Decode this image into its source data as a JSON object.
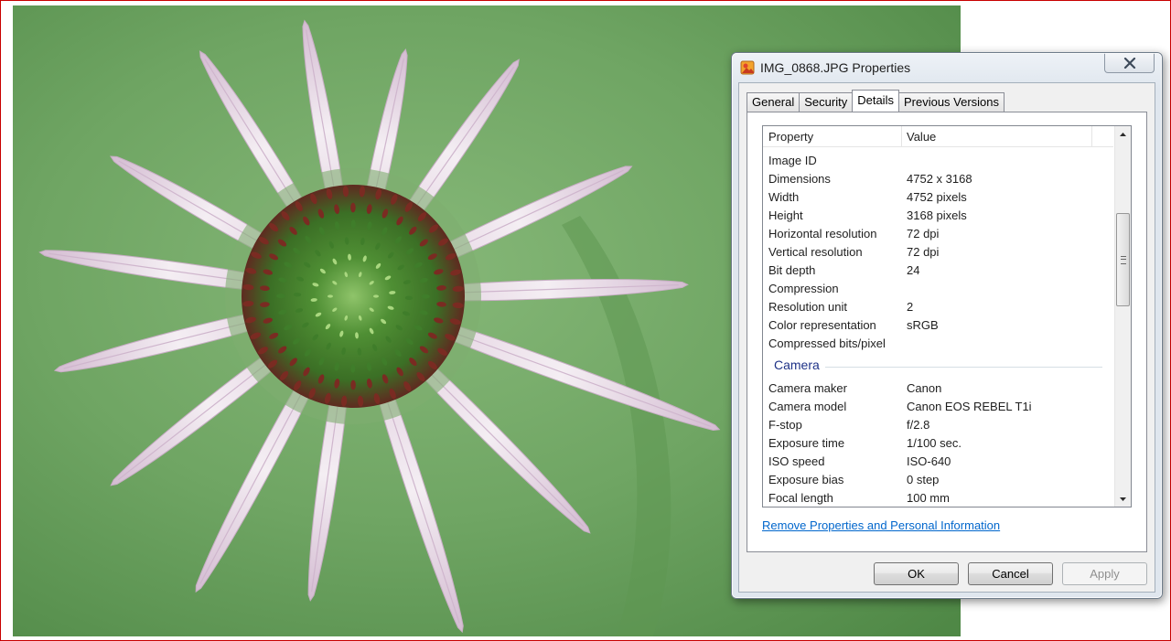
{
  "window": {
    "title": "IMG_0868.JPG Properties"
  },
  "tabs": [
    {
      "label": "General"
    },
    {
      "label": "Security"
    },
    {
      "label": "Details"
    },
    {
      "label": "Previous Versions"
    }
  ],
  "active_tab": "Details",
  "list": {
    "header_property": "Property",
    "header_value": "Value",
    "image_rows": [
      {
        "property": "Image ID",
        "value": ""
      },
      {
        "property": "Dimensions",
        "value": "4752 x 3168"
      },
      {
        "property": "Width",
        "value": "4752 pixels"
      },
      {
        "property": "Height",
        "value": "3168 pixels"
      },
      {
        "property": "Horizontal resolution",
        "value": "72 dpi"
      },
      {
        "property": "Vertical resolution",
        "value": "72 dpi"
      },
      {
        "property": "Bit depth",
        "value": "24"
      },
      {
        "property": "Compression",
        "value": ""
      },
      {
        "property": "Resolution unit",
        "value": "2"
      },
      {
        "property": "Color representation",
        "value": "sRGB"
      },
      {
        "property": "Compressed bits/pixel",
        "value": ""
      }
    ],
    "camera_group": "Camera",
    "camera_rows": [
      {
        "property": "Camera maker",
        "value": "Canon"
      },
      {
        "property": "Camera model",
        "value": "Canon EOS REBEL T1i"
      },
      {
        "property": "F-stop",
        "value": "f/2.8"
      },
      {
        "property": "Exposure time",
        "value": "1/100 sec."
      },
      {
        "property": "ISO speed",
        "value": "ISO-640"
      },
      {
        "property": "Exposure bias",
        "value": "0 step"
      },
      {
        "property": "Focal length",
        "value": "100 mm"
      }
    ]
  },
  "remove_link": "Remove Properties and Personal Information",
  "buttons": {
    "ok": "OK",
    "cancel": "Cancel",
    "apply": "Apply"
  },
  "colors": {
    "link": "#0066cc",
    "group_header": "#1e3287",
    "photo_background": "#6aa060"
  },
  "icons": {
    "title": "image-file-icon",
    "close": "close-icon"
  }
}
